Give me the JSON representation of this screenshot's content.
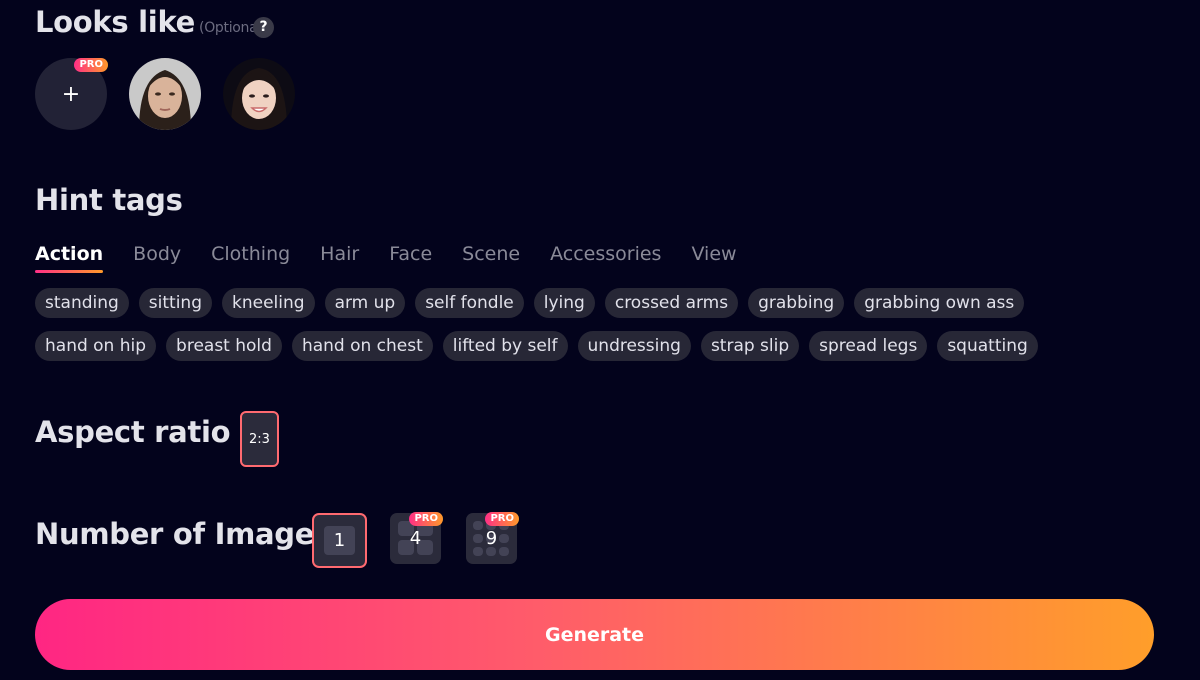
{
  "looks_like": {
    "title": "Looks like",
    "optional": "(Optional)",
    "help": "?",
    "add_label": "+",
    "pro": "PRO"
  },
  "hint_tags": {
    "title": "Hint tags",
    "tabs": [
      "Action",
      "Body",
      "Clothing",
      "Hair",
      "Face",
      "Scene",
      "Accessories",
      "View"
    ],
    "active_tab": "Action",
    "tags": [
      "standing",
      "sitting",
      "kneeling",
      "arm up",
      "self fondle",
      "lying",
      "crossed arms",
      "grabbing",
      "grabbing own ass",
      "hand on hip",
      "breast hold",
      "hand on chest",
      "lifted by self",
      "undressing",
      "strap slip",
      "spread legs",
      "squatting"
    ]
  },
  "aspect_ratio": {
    "title": "Aspect ratio",
    "selected": "2:3"
  },
  "number_of_image": {
    "title": "Number of Image",
    "options": [
      "1",
      "4",
      "9"
    ],
    "pro": "PRO"
  },
  "generate": {
    "label": "Generate"
  },
  "colors": {
    "background": "#03031c",
    "accent_start": "#ff2683",
    "accent_end": "#ff9e2a"
  }
}
